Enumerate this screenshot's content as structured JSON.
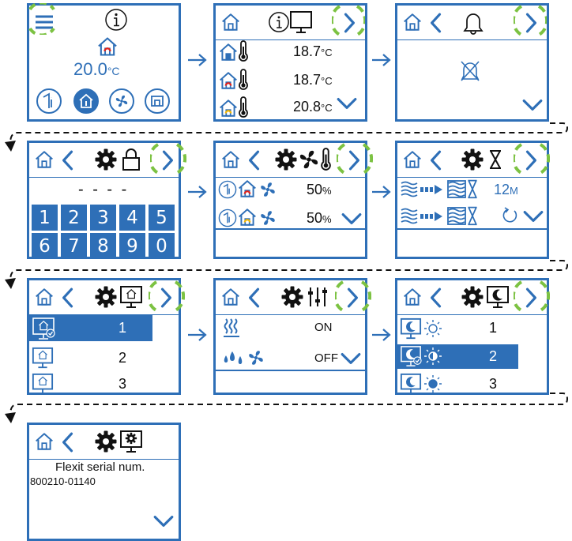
{
  "screens": {
    "home": {
      "temperature": "20.0",
      "temperature_unit": "°C"
    },
    "info": {
      "rows": [
        {
          "value": "18.7",
          "unit": "°C"
        },
        {
          "value": "18.7",
          "unit": "°C"
        },
        {
          "value": "20.8",
          "unit": "°C"
        }
      ]
    },
    "lock": {
      "code_display": "- - - -",
      "keys": [
        "1",
        "2",
        "3",
        "4",
        "5",
        "6",
        "7",
        "8",
        "9",
        "0"
      ]
    },
    "fan": {
      "rows": [
        {
          "value": "50",
          "unit": "%"
        },
        {
          "value": "50",
          "unit": "%"
        }
      ]
    },
    "timer": {
      "value": "12",
      "unit": "M"
    },
    "mode": {
      "options": [
        "1",
        "2",
        "3"
      ],
      "selected_index": 0
    },
    "settings": {
      "rows": [
        {
          "value": "ON"
        },
        {
          "value": "OFF"
        }
      ]
    },
    "sleep": {
      "options": [
        "1",
        "2",
        "3"
      ],
      "selected_index": 1
    },
    "serial": {
      "label": "Flexit serial num.",
      "number": "800210-01140"
    }
  },
  "colors": {
    "accent": "#2e6fb7",
    "highlight": "#7cc242",
    "alarm": "#e0231d",
    "warning": "#f2b705"
  },
  "icons": [
    "menu-icon",
    "info-icon",
    "home-icon",
    "chevron-left-icon",
    "chevron-right-icon",
    "chevron-down-icon",
    "bell-icon",
    "alarm-off-icon",
    "gear-icon",
    "lock-icon",
    "fan-icon",
    "thermometer-icon",
    "hourglass-icon",
    "sliders-icon",
    "monitor-icon",
    "moon-icon",
    "sun-icon",
    "heater-icon",
    "drops-icon"
  ]
}
